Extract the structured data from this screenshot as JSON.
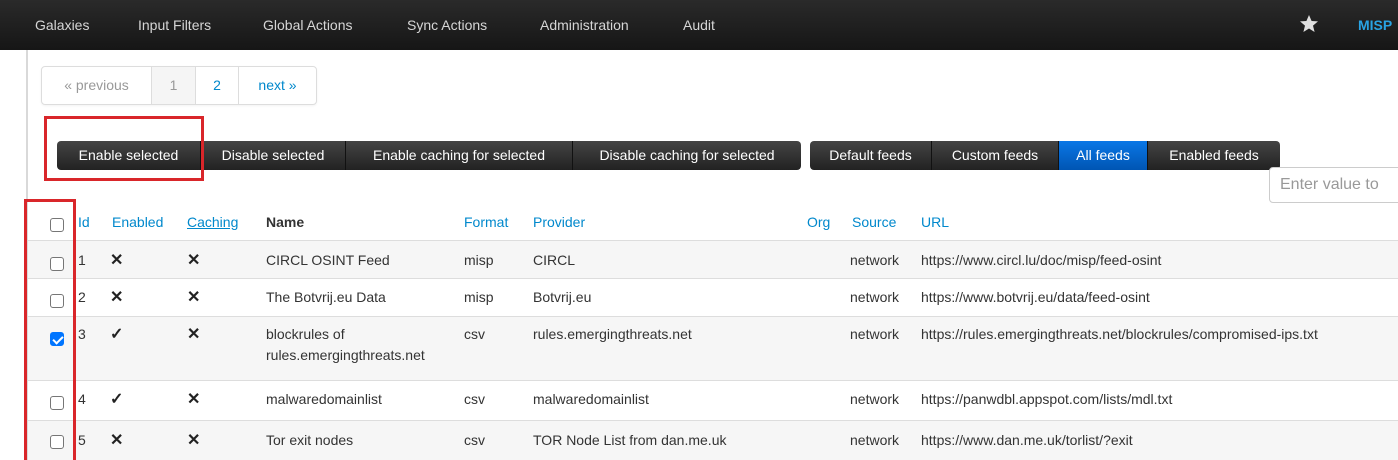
{
  "nav": {
    "items": [
      "Galaxies",
      "Input Filters",
      "Global Actions",
      "Sync Actions",
      "Administration",
      "Audit"
    ],
    "brand": "MISP",
    "star_icon": "star-icon"
  },
  "pagination": {
    "previous": "« previous",
    "pages": [
      "1",
      "2"
    ],
    "next": "next »"
  },
  "actions": {
    "enable_selected": "Enable selected",
    "disable_selected": "Disable selected",
    "enable_caching": "Enable caching for selected",
    "disable_caching": "Disable caching for selected"
  },
  "filters": {
    "default_feeds": "Default feeds",
    "custom_feeds": "Custom feeds",
    "all_feeds": "All feeds",
    "enabled_feeds": "Enabled feeds"
  },
  "search": {
    "placeholder": "Enter value to"
  },
  "table": {
    "headers": {
      "id": "Id",
      "enabled": "Enabled",
      "caching": "Caching",
      "name": "Name",
      "format": "Format",
      "provider": "Provider",
      "org": "Org",
      "source": "Source",
      "url": "URL"
    },
    "rows": [
      {
        "checked": false,
        "id": "1",
        "enabled": "✕",
        "caching": "✕",
        "name": "CIRCL OSINT Feed",
        "format": "misp",
        "provider": "CIRCL",
        "org": "",
        "source": "network",
        "url": "https://www.circl.lu/doc/misp/feed-osint"
      },
      {
        "checked": false,
        "id": "2",
        "enabled": "✕",
        "caching": "✕",
        "name": "The Botvrij.eu Data",
        "format": "misp",
        "provider": "Botvrij.eu",
        "org": "",
        "source": "network",
        "url": "https://www.botvrij.eu/data/feed-osint"
      },
      {
        "checked": true,
        "id": "3",
        "enabled": "✓",
        "caching": "✕",
        "name": "blockrules of rules.emergingthreats.net",
        "format": "csv",
        "provider": "rules.emergingthreats.net",
        "org": "",
        "source": "network",
        "url": "https://rules.emergingthreats.net/blockrules/compromised-ips.txt"
      },
      {
        "checked": false,
        "id": "4",
        "enabled": "✓",
        "caching": "✕",
        "name": "malwaredomainlist",
        "format": "csv",
        "provider": "malwaredomainlist",
        "org": "",
        "source": "network",
        "url": "https://panwdbl.appspot.com/lists/mdl.txt"
      },
      {
        "checked": false,
        "id": "5",
        "enabled": "✕",
        "caching": "✕",
        "name": "Tor exit nodes",
        "format": "csv",
        "provider": "TOR Node List from dan.me.uk",
        "org": "",
        "source": "network",
        "url": "https://www.dan.me.uk/torlist/?exit"
      }
    ]
  },
  "colors": {
    "navbar": "#1d1d1d",
    "link": "#0088cc",
    "active_filter": "#0066cc",
    "highlight": "#d9262a"
  }
}
